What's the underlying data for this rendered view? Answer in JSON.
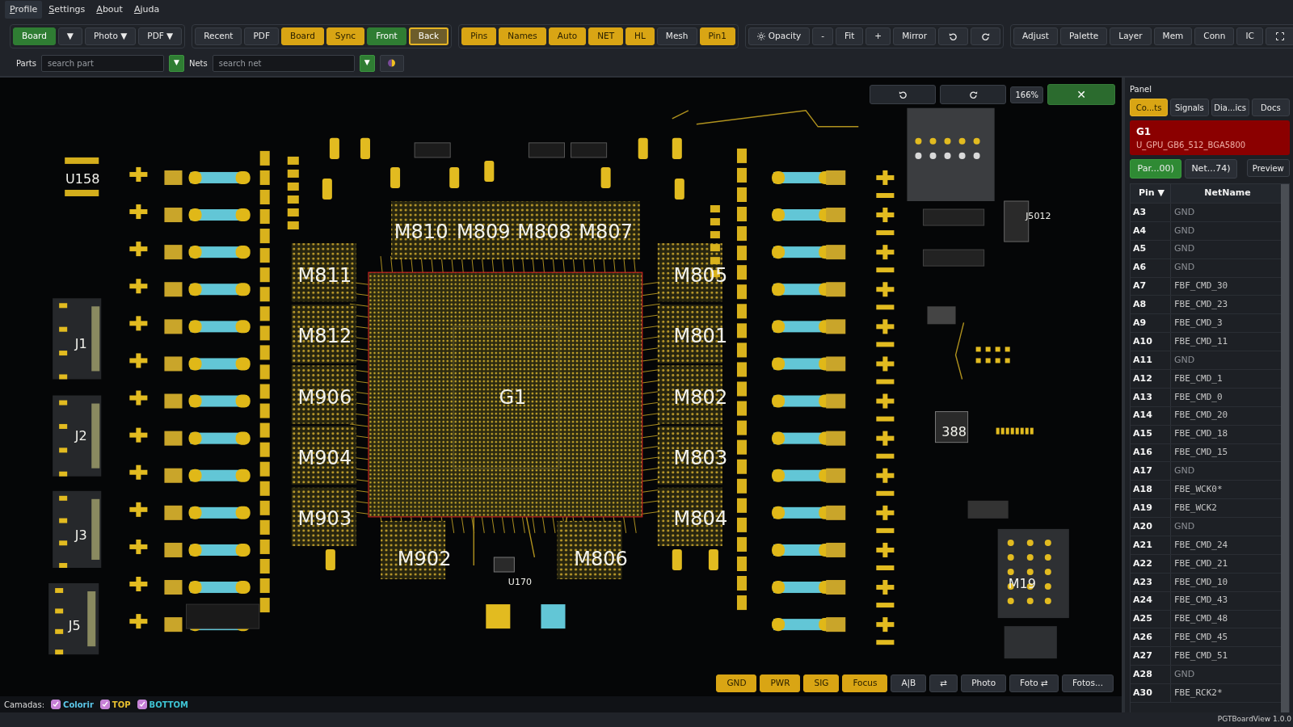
{
  "menu": [
    {
      "label": "Profile",
      "selected": true
    },
    {
      "label": "Settings",
      "selected": false
    },
    {
      "label": "About",
      "selected": false
    },
    {
      "label": "Ajuda",
      "selected": false
    }
  ],
  "toolbar": {
    "groups": [
      [
        {
          "label": "Board",
          "on": true,
          "color": "#2f7d33"
        },
        {
          "label": "▼",
          "on": false
        },
        {
          "label": "Photo ▼",
          "on": false
        },
        {
          "label": "PDF ▼",
          "on": false
        }
      ],
      [
        {
          "label": "Recent",
          "on": false,
          "selected": false
        },
        {
          "label": "PDF",
          "on": false,
          "selected": false
        },
        {
          "label": "Board",
          "on": true,
          "color": "#d9a514",
          "selected": false
        },
        {
          "label": "Sync",
          "on": true,
          "color": "#d9a514",
          "selected": false
        },
        {
          "label": "Front",
          "on": true,
          "color": "#2f7d33",
          "selected": false
        },
        {
          "label": "Back",
          "on": true,
          "color": "#6d5d2b",
          "selected": true
        }
      ],
      [
        {
          "label": "Pins",
          "on": true,
          "color": "#d9a514"
        },
        {
          "label": "Names",
          "on": true,
          "color": "#d9a514"
        },
        {
          "label": "Auto",
          "on": true,
          "color": "#d9a514"
        },
        {
          "label": "NET",
          "on": true,
          "color": "#d9a514"
        },
        {
          "label": "HL",
          "on": true,
          "color": "#d9a514"
        },
        {
          "label": "Mesh",
          "on": false
        },
        {
          "label": "Pin1",
          "on": true,
          "color": "#d9a514"
        }
      ],
      [
        {
          "label": "Opacity",
          "on": false
        },
        {
          "label": "-",
          "on": false
        },
        {
          "label": "Fit",
          "on": false
        },
        {
          "label": "+",
          "on": false
        },
        {
          "label": "Mirror",
          "on": false
        },
        {
          "on": false
        },
        {
          "on": false
        }
      ],
      [
        {
          "label": "Adjust",
          "on": false
        },
        {
          "label": "Palette",
          "on": false
        },
        {
          "label": "Layer",
          "on": false
        },
        {
          "label": "Mem",
          "on": false
        },
        {
          "label": "Conn",
          "on": false
        },
        {
          "label": "IC",
          "on": false
        },
        {
          "on": false
        }
      ]
    ]
  },
  "search": [
    {
      "label": "Parts",
      "placeholder": "search part",
      "button": "▼"
    },
    {
      "label": "Nets",
      "placeholder": "search net",
      "button": "▼"
    }
  ],
  "canvas": {
    "zoom": "166%",
    "close": "✕",
    "labels": [
      {
        "text": "M810",
        "kind": "memory"
      },
      {
        "text": "M809",
        "kind": "memory"
      },
      {
        "text": "M808",
        "kind": "memory"
      },
      {
        "text": "M807",
        "kind": "memory"
      },
      {
        "text": "M811",
        "kind": "memory"
      },
      {
        "text": "M805",
        "kind": "memory"
      },
      {
        "text": "M812",
        "kind": "memory"
      },
      {
        "text": "M801",
        "kind": "memory"
      },
      {
        "text": "M906",
        "kind": "memory"
      },
      {
        "text": "G1",
        "kind": "memory"
      },
      {
        "text": "M802",
        "kind": "memory"
      },
      {
        "text": "M904",
        "kind": "memory"
      },
      {
        "text": "M803",
        "kind": "memory"
      },
      {
        "text": "M903",
        "kind": "memory"
      },
      {
        "text": "M804",
        "kind": "memory"
      },
      {
        "text": "M902",
        "kind": "memory"
      },
      {
        "text": "M806",
        "kind": "memory"
      },
      {
        "text": "U158",
        "kind": "part"
      },
      {
        "text": "J1",
        "kind": "part"
      },
      {
        "text": "J2",
        "kind": "part"
      },
      {
        "text": "J3",
        "kind": "part"
      },
      {
        "text": "J5",
        "kind": "part"
      },
      {
        "text": "J5012",
        "kind": "small"
      },
      {
        "text": "388",
        "kind": "part"
      },
      {
        "text": "U170",
        "kind": "small"
      },
      {
        "text": "M19",
        "kind": "part"
      }
    ],
    "buttons": [
      {
        "label": "GND",
        "on": true,
        "color": "#d9a514"
      },
      {
        "label": "PWR",
        "on": true,
        "color": "#d9a514"
      },
      {
        "label": "SIG",
        "on": true,
        "color": "#d9a514"
      },
      {
        "label": "Focus",
        "on": true,
        "color": "#d9a514"
      },
      {
        "label": "A|B",
        "on": false
      },
      {
        "label": "⇄",
        "on": false
      },
      {
        "label": "Photo",
        "on": false
      },
      {
        "label": "Foto ⇄",
        "on": false
      },
      {
        "label": "Fotos...",
        "on": false
      }
    ]
  },
  "layers": {
    "label": "Camadas:",
    "items": [
      {
        "label": "Colorir",
        "checked": true,
        "color": "#5cc8ea"
      },
      {
        "label": "TOP",
        "checked": true,
        "color": "#e8c030"
      },
      {
        "label": "BOTTOM",
        "checked": true,
        "color": "#3ec4d4"
      }
    ]
  },
  "panel": {
    "title": "Panel",
    "tabs": [
      {
        "label": "Co...ts",
        "selected": true
      },
      {
        "label": "Signals",
        "selected": false
      },
      {
        "label": "Dia...ics",
        "selected": false
      },
      {
        "label": "Docs",
        "selected": false
      }
    ],
    "part": {
      "name": "G1",
      "description": "U_GPU_GB6_512_BGA5800"
    },
    "subtabs": [
      {
        "label": "Par...00)",
        "selected": true
      },
      {
        "label": "Net...74)",
        "selected": false
      }
    ],
    "preview": "Preview",
    "columns": [
      "Pin ▼",
      "NetName"
    ],
    "rows": [
      {
        "pin": "A3",
        "net": "GND",
        "kind": "ground"
      },
      {
        "pin": "A4",
        "net": "GND",
        "kind": "ground"
      },
      {
        "pin": "A5",
        "net": "GND",
        "kind": "ground"
      },
      {
        "pin": "A6",
        "net": "GND",
        "kind": "ground"
      },
      {
        "pin": "A7",
        "net": "FBF_CMD_30",
        "kind": "signal"
      },
      {
        "pin": "A8",
        "net": "FBE_CMD_23",
        "kind": "signal"
      },
      {
        "pin": "A9",
        "net": "FBE_CMD_3",
        "kind": "signal"
      },
      {
        "pin": "A10",
        "net": "FBE_CMD_11",
        "kind": "signal"
      },
      {
        "pin": "A11",
        "net": "GND",
        "kind": "ground"
      },
      {
        "pin": "A12",
        "net": "FBE_CMD_1",
        "kind": "signal"
      },
      {
        "pin": "A13",
        "net": "FBE_CMD_0",
        "kind": "signal"
      },
      {
        "pin": "A14",
        "net": "FBE_CMD_20",
        "kind": "signal"
      },
      {
        "pin": "A15",
        "net": "FBE_CMD_18",
        "kind": "signal"
      },
      {
        "pin": "A16",
        "net": "FBE_CMD_15",
        "kind": "signal"
      },
      {
        "pin": "A17",
        "net": "GND",
        "kind": "ground"
      },
      {
        "pin": "A18",
        "net": "FBE_WCK0*",
        "kind": "signal"
      },
      {
        "pin": "A19",
        "net": "FBE_WCK2",
        "kind": "signal"
      },
      {
        "pin": "A20",
        "net": "GND",
        "kind": "ground"
      },
      {
        "pin": "A21",
        "net": "FBE_CMD_24",
        "kind": "signal"
      },
      {
        "pin": "A22",
        "net": "FBE_CMD_21",
        "kind": "signal"
      },
      {
        "pin": "A23",
        "net": "FBE_CMD_10",
        "kind": "signal"
      },
      {
        "pin": "A24",
        "net": "FBE_CMD_43",
        "kind": "signal"
      },
      {
        "pin": "A25",
        "net": "FBE_CMD_48",
        "kind": "signal"
      },
      {
        "pin": "A26",
        "net": "FBE_CMD_45",
        "kind": "signal"
      },
      {
        "pin": "A27",
        "net": "FBE_CMD_51",
        "kind": "signal"
      },
      {
        "pin": "A28",
        "net": "GND",
        "kind": "ground"
      },
      {
        "pin": "A30",
        "net": "FBE_RCK2*",
        "kind": "signal"
      }
    ]
  },
  "status_bar": {
    "version": "PGTBoardView 1.0.0"
  }
}
